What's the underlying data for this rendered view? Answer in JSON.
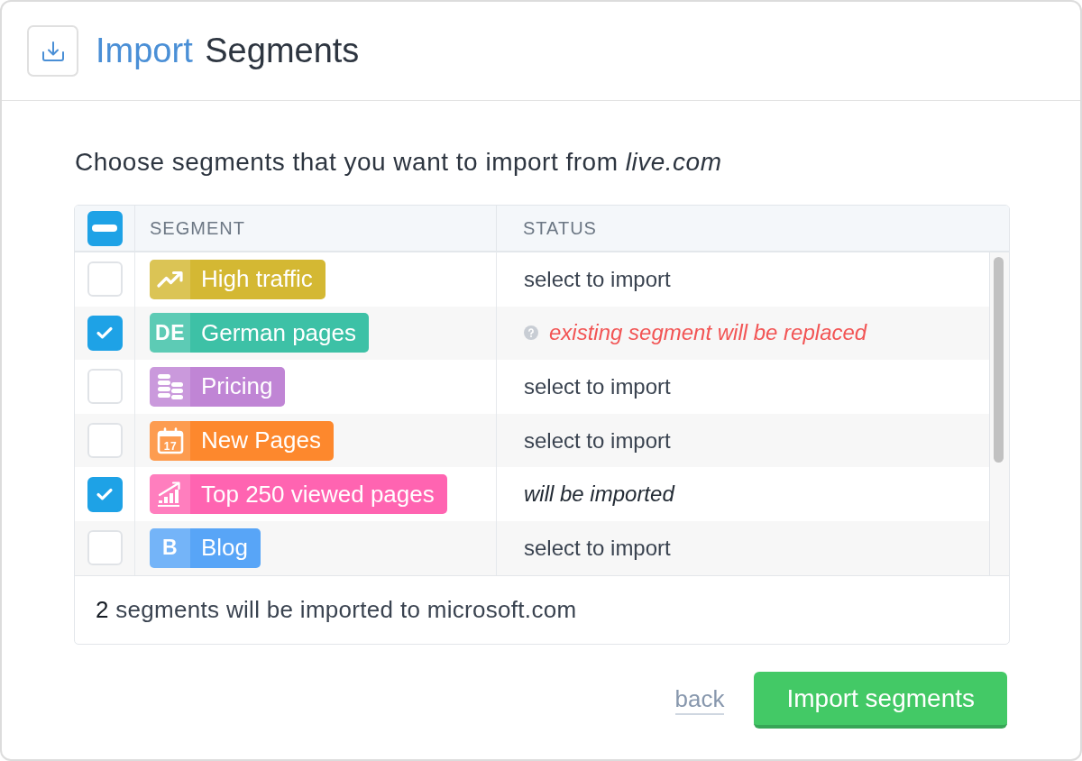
{
  "header": {
    "title_accent": "Import",
    "title": "Segments"
  },
  "description": "Choose segments that you want to import from *live.com*",
  "table": {
    "columns": [
      "SEGMENT",
      "STATUS"
    ],
    "select_all": {
      "indeterminate": true
    },
    "rows": [
      {
        "checked": false,
        "name": "High traffic",
        "icon": {
          "kind": "trend"
        },
        "color": "#d4b833",
        "status": {
          "kind": "plain",
          "text": "select to import"
        }
      },
      {
        "checked": true,
        "name": "German pages",
        "icon": {
          "kind": "initials",
          "text": "DE"
        },
        "color": "#3dc1a6",
        "status": {
          "kind": "warning",
          "text": "existing segment will be replaced"
        }
      },
      {
        "checked": false,
        "name": "Pricing",
        "icon": {
          "kind": "coins"
        },
        "color": "#c085d5",
        "status": {
          "kind": "plain",
          "text": "select to import"
        }
      },
      {
        "checked": false,
        "name": "New Pages",
        "icon": {
          "kind": "calendar",
          "text": "17"
        },
        "color": "#fd882d",
        "status": {
          "kind": "plain",
          "text": "select to import"
        }
      },
      {
        "checked": true,
        "name": "Top 250 viewed pages",
        "icon": {
          "kind": "growth"
        },
        "color": "#ff64b1",
        "status": {
          "kind": "pending",
          "text": "will be imported"
        }
      },
      {
        "checked": false,
        "name": "Blog",
        "icon": {
          "kind": "initials",
          "text": "B"
        },
        "color": "#58a5f7",
        "status": {
          "kind": "plain",
          "text": "select to import"
        }
      }
    ],
    "summary": "**2** segments will be imported to microsoft.com"
  },
  "actions": {
    "back": "back",
    "primary": "Import segments"
  }
}
